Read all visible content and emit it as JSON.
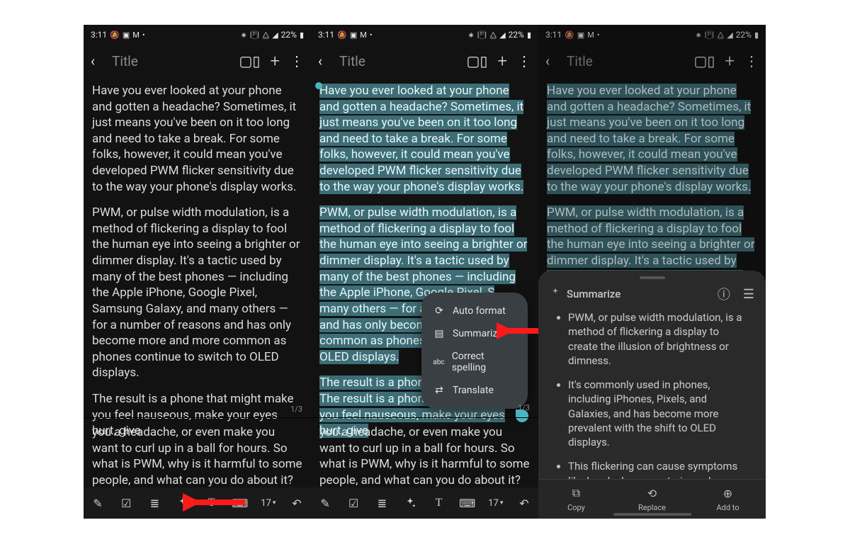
{
  "status_bar": {
    "time": "3:11",
    "left_icons": [
      "silent-mode-icon",
      "image-icon",
      "mail-icon",
      "dot-icon"
    ],
    "right_icons": [
      "bluetooth-icon",
      "vibrate-icon",
      "wifi-icon",
      "signal-icon"
    ],
    "battery_pct": "22%"
  },
  "header": {
    "back_icon": "chevron-left-icon",
    "title_placeholder": "Title",
    "actions": {
      "reader": "book-icon",
      "add": "plus-icon",
      "more": "more-vertical-icon"
    }
  },
  "note": {
    "p1": "Have you ever looked at your phone and gotten a headache? Sometimes, it just means you've been on it too long and need to take a break. For some folks, however, it could mean you've developed PWM flicker sensitivity due to the way your phone's display works.",
    "p2": "PWM, or pulse width modulation, is a method of flickering a display to fool the human eye into seeing a brighter or dimmer display. It's a tactic used by many of the best phones — including the Apple iPhone, Google Pixel, Samsung Galaxy, and many others — for a number of reasons and has only become more and more common as phones continue to switch to OLED displays.",
    "p2_cut_a": "PWM, or pulse width modulation, is a method of flickering a display to fool the human eye into seeing a brighter or dimmer display. It's a tactic used by many of the best phones — including the Apple iPhone, Google Pixel, S",
    "p2_cut_b": "many others — for a n",
    "p2_cut_c": "and has only become",
    "p2_cut_d": "common as phones co",
    "p2_cut_e": "OLED displays.",
    "p2_panel3": "PWM, or pulse width modulation, is a method of flickering a display to fool the human eye into seeing a brighter or dimmer display. It's a tactic used by many of the best phones — including the Apple",
    "p3": "The result is a phone that might make you feel nauseous, make your eyes hurt, give",
    "p3_cut": "The result is a phone t",
    "p4": "you a headache, or even make you want to curl up in a ball for hours. So what is PWM, why is it harmful to some people, and what can you do about it? Other than getting a new PWM-friendly phone, we've got several suggestions that will help make",
    "page_count": "1/3",
    "page_count_2": "1/3"
  },
  "toolbar": {
    "items": [
      "pen-icon",
      "checkbox-icon",
      "text-format-icon",
      "ai-sparkle-icon",
      "text-style-icon",
      "font-icon"
    ],
    "font_size_label": "17",
    "undo": "undo-icon"
  },
  "context_menu": {
    "items": [
      {
        "icon": "auto-format-icon",
        "label": "Auto format"
      },
      {
        "icon": "summarize-icon",
        "label": "Summarize"
      },
      {
        "icon": "spellcheck-icon",
        "label": "Correct spelling"
      },
      {
        "icon": "translate-icon",
        "label": "Translate"
      }
    ]
  },
  "summary_panel": {
    "title": "Summarize",
    "header_actions": {
      "info": "info-circle-icon",
      "list": "list-outline-icon"
    },
    "bullets": [
      "PWM, or pulse width modulation, is a method of flickering a display to create the illusion of brightness or dimness.",
      "It's commonly used in phones, including iPhones, Pixels, and Galaxies, and has become more prevalent with the shift to OLED displays.",
      "This flickering can cause symptoms like headaches, eye strain, and nausea in some individuals, known as PWM flicker sensitivity."
    ],
    "footer": {
      "copy": "Copy",
      "replace": "Replace",
      "add_to": "Add to"
    }
  },
  "arrows": {
    "left_arrow_target": "ai-sparkle-toolbar-button",
    "right_arrow_target": "summarize-menu-item"
  }
}
